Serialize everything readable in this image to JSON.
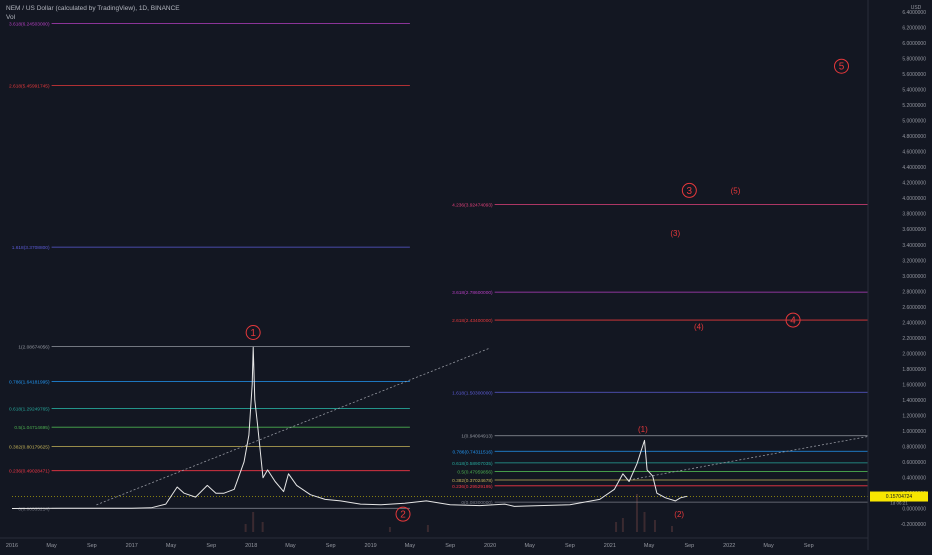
{
  "header": {
    "title": "NEM / US Dollar (calculated by TradingView), 1D, BINANCE",
    "indicator": "Vol"
  },
  "colors": {
    "background": "#131722",
    "price": "#e6e6e6",
    "volume": "#3a2a30",
    "wave_label": "#e5383b",
    "trend": "#9598a1",
    "axis_text": "#9598a1",
    "last_price_bg": "#f7e600",
    "last_price_line": "#f7e600"
  },
  "chart_data": {
    "type": "line",
    "symbol": "XEMUSD",
    "y_unit": "USD",
    "ylim": [
      -0.3,
      6.45
    ],
    "y_ticks": [
      -0.2,
      0,
      0.2,
      0.4,
      0.6,
      0.8,
      1.0,
      1.2,
      1.4,
      1.6,
      1.8,
      2.0,
      2.2,
      2.4,
      2.6,
      2.8,
      3.0,
      3.2,
      3.4,
      3.6,
      3.8,
      4.0,
      4.2,
      4.4,
      4.6,
      4.8,
      5.0,
      5.2,
      5.4,
      5.6,
      5.8,
      6.0,
      6.2,
      6.4
    ],
    "y_tick_labels": [
      "-0.2000000",
      "0.0000000",
      "0.2000000",
      "0.4000000",
      "0.6000000",
      "0.8000000",
      "1.0000000",
      "1.2000000",
      "1.4000000",
      "1.6000000",
      "1.8000000",
      "2.0000000",
      "2.2000000",
      "2.4000000",
      "2.6000000",
      "2.8000000",
      "3.0000000",
      "3.2000000",
      "3.4000000",
      "3.6000000",
      "3.8000000",
      "4.0000000",
      "4.2000000",
      "4.4000000",
      "4.6000000",
      "4.8000000",
      "5.0000000",
      "5.2000000",
      "5.4000000",
      "5.6000000",
      "5.8000000",
      "6.0000000",
      "6.2000000",
      "6.4000000"
    ],
    "xlim": [
      "2016-01-01",
      "2023-03-01"
    ],
    "x_ticks": [
      {
        "date": "2016-01-01",
        "label": "2016"
      },
      {
        "date": "2016-05-01",
        "label": "May"
      },
      {
        "date": "2016-09-01",
        "label": "Sep"
      },
      {
        "date": "2017-01-01",
        "label": "2017"
      },
      {
        "date": "2017-05-01",
        "label": "May"
      },
      {
        "date": "2017-09-01",
        "label": "Sep"
      },
      {
        "date": "2018-01-01",
        "label": "2018"
      },
      {
        "date": "2018-05-01",
        "label": "May"
      },
      {
        "date": "2018-09-01",
        "label": "Sep"
      },
      {
        "date": "2019-01-01",
        "label": "2019"
      },
      {
        "date": "2019-05-01",
        "label": "May"
      },
      {
        "date": "2019-09-01",
        "label": "Sep"
      },
      {
        "date": "2020-01-01",
        "label": "2020"
      },
      {
        "date": "2020-05-01",
        "label": "May"
      },
      {
        "date": "2020-09-01",
        "label": "Sep"
      },
      {
        "date": "2021-01-01",
        "label": "2021"
      },
      {
        "date": "2021-05-01",
        "label": "May"
      },
      {
        "date": "2021-09-01",
        "label": "Sep"
      },
      {
        "date": "2022-01-01",
        "label": "2022"
      },
      {
        "date": "2022-05-01",
        "label": "May"
      },
      {
        "date": "2022-09-01",
        "label": "Sep"
      }
    ],
    "series": [
      {
        "points": [
          [
            "2016-01-01",
            0.003
          ],
          [
            "2016-06-01",
            0.005
          ],
          [
            "2016-10-01",
            0.006
          ],
          [
            "2017-01-01",
            0.006
          ],
          [
            "2017-03-01",
            0.012
          ],
          [
            "2017-04-15",
            0.06
          ],
          [
            "2017-05-20",
            0.28
          ],
          [
            "2017-06-10",
            0.2
          ],
          [
            "2017-07-15",
            0.15
          ],
          [
            "2017-08-20",
            0.3
          ],
          [
            "2017-09-15",
            0.2
          ],
          [
            "2017-10-10",
            0.2
          ],
          [
            "2017-11-10",
            0.25
          ],
          [
            "2017-12-10",
            0.6
          ],
          [
            "2017-12-25",
            0.95
          ],
          [
            "2018-01-04",
            1.6
          ],
          [
            "2018-01-07",
            2.08
          ],
          [
            "2018-01-12",
            1.4
          ],
          [
            "2018-01-20",
            1.1
          ],
          [
            "2018-02-06",
            0.4
          ],
          [
            "2018-02-20",
            0.5
          ],
          [
            "2018-03-15",
            0.35
          ],
          [
            "2018-04-10",
            0.22
          ],
          [
            "2018-04-25",
            0.45
          ],
          [
            "2018-05-20",
            0.3
          ],
          [
            "2018-07-01",
            0.18
          ],
          [
            "2018-08-15",
            0.12
          ],
          [
            "2018-10-01",
            0.1
          ],
          [
            "2018-12-01",
            0.06
          ],
          [
            "2019-02-01",
            0.05
          ],
          [
            "2019-04-15",
            0.07
          ],
          [
            "2019-06-20",
            0.1
          ],
          [
            "2019-09-01",
            0.05
          ],
          [
            "2019-12-01",
            0.04
          ],
          [
            "2020-02-15",
            0.06
          ],
          [
            "2020-03-15",
            0.03
          ],
          [
            "2020-06-01",
            0.04
          ],
          [
            "2020-09-01",
            0.05
          ],
          [
            "2020-12-01",
            0.12
          ],
          [
            "2021-01-15",
            0.25
          ],
          [
            "2021-02-10",
            0.45
          ],
          [
            "2021-03-01",
            0.35
          ],
          [
            "2021-03-25",
            0.58
          ],
          [
            "2021-04-17",
            0.88
          ],
          [
            "2021-04-25",
            0.5
          ],
          [
            "2021-05-12",
            0.42
          ],
          [
            "2021-05-25",
            0.2
          ],
          [
            "2021-06-20",
            0.14
          ],
          [
            "2021-07-20",
            0.1
          ],
          [
            "2021-08-05",
            0.14
          ],
          [
            "2021-08-25",
            0.16
          ]
        ]
      }
    ],
    "volume_spikes": [
      [
        "2017-12-15",
        0.4
      ],
      [
        "2018-01-07",
        1.0
      ],
      [
        "2018-02-05",
        0.5
      ],
      [
        "2019-03-01",
        0.25
      ],
      [
        "2019-06-25",
        0.35
      ],
      [
        "2021-01-20",
        0.5
      ],
      [
        "2021-02-10",
        0.7
      ],
      [
        "2021-03-25",
        1.9
      ],
      [
        "2021-04-17",
        1.0
      ],
      [
        "2021-05-19",
        0.6
      ],
      [
        "2021-07-10",
        0.3
      ]
    ],
    "fib_sets": [
      {
        "x_start": "2016-05-01",
        "x_end": "2019-05-01",
        "levels": [
          {
            "label": "0(0.00535214)",
            "y": 0.005,
            "color": "#787b86"
          },
          {
            "label": "0.236(0.49028471)",
            "y": 0.49,
            "color": "#f23645"
          },
          {
            "label": "0.382(0.80179625)",
            "y": 0.8,
            "color": "#c5b358"
          },
          {
            "label": "0.5(1.04714695)",
            "y": 1.05,
            "color": "#4caf50"
          },
          {
            "label": "0.618(1.29249765)",
            "y": 1.29,
            "color": "#26a69a"
          },
          {
            "label": "0.786(1.64181995)",
            "y": 1.64,
            "color": "#2196f3"
          },
          {
            "label": "1(2.08674056)",
            "y": 2.09,
            "color": "#9598a1"
          }
        ]
      },
      {
        "x_start": "2016-05-01",
        "x_end": "2019-05-01",
        "levels": [
          {
            "label": "1.618(3.3708800)",
            "y": 3.37,
            "color": "#5b5bd6"
          },
          {
            "label": "2.618(5.45991745)",
            "y": 5.45,
            "color": "#e5383b"
          },
          {
            "label": "3.618(6.24503000)",
            "y": 6.25,
            "color": "#b43fc1"
          }
        ]
      },
      {
        "x_start": "2020-01-15",
        "x_end": "2023-03-01",
        "levels": [
          {
            "label": "0(0.08300000)",
            "y": 0.085,
            "color": "#787b86"
          },
          {
            "label": "0.236(0.29529195)",
            "y": 0.295,
            "color": "#f23645"
          },
          {
            "label": "0.382(0.37024678)",
            "y": 0.37,
            "color": "#c5b358"
          },
          {
            "label": "0.5(0.47959856)",
            "y": 0.48,
            "color": "#4caf50"
          },
          {
            "label": "0.618(0.58907035)",
            "y": 0.59,
            "color": "#26a69a"
          },
          {
            "label": "0.786(0.74311516)",
            "y": 0.74,
            "color": "#2196f3"
          },
          {
            "label": "1(0.94004913)",
            "y": 0.94,
            "color": "#9598a1"
          },
          {
            "label": "1.618(1.50300000)",
            "y": 1.5,
            "color": "#5b5bd6"
          },
          {
            "label": "2.618(2.43400000)",
            "y": 2.43,
            "color": "#e5383b"
          },
          {
            "label": "3.618(2.78600000)",
            "y": 2.79,
            "color": "#b43fc1"
          },
          {
            "label": "4.236(3.92474093)",
            "y": 3.92,
            "color": "#e0407a"
          }
        ]
      }
    ],
    "trend_lines": [
      {
        "from": [
          "2016-09-15",
          0.05
        ],
        "to": [
          "2020-01-01",
          2.07
        ]
      },
      {
        "from": [
          "2021-03-01",
          0.37
        ],
        "to": [
          "2023-03-01",
          0.93
        ]
      }
    ],
    "wave_labels": [
      {
        "text": "1",
        "x": "2018-01-07",
        "y": 2.27,
        "circled": true
      },
      {
        "text": "2",
        "x": "2019-04-10",
        "y": -0.07,
        "circled": true
      },
      {
        "text": "3",
        "x": "2021-09-01",
        "y": 4.1,
        "circled": true
      },
      {
        "text": "4",
        "x": "2022-07-15",
        "y": 2.43,
        "circled": true
      },
      {
        "text": "5",
        "x": "2022-12-10",
        "y": 5.7,
        "circled": true
      },
      {
        "text": "(1)",
        "x": "2021-04-12",
        "y": 1.03,
        "circled": false
      },
      {
        "text": "(2)",
        "x": "2021-08-01",
        "y": -0.07,
        "circled": false
      },
      {
        "text": "(3)",
        "x": "2021-07-20",
        "y": 3.55,
        "circled": false
      },
      {
        "text": "(4)",
        "x": "2021-09-30",
        "y": 2.35,
        "circled": false
      },
      {
        "text": "(5)",
        "x": "2022-01-20",
        "y": 4.1,
        "circled": false
      }
    ],
    "last_price": {
      "value": 0.157,
      "label": "0.15704724",
      "countdown": "1d 06:21"
    }
  }
}
